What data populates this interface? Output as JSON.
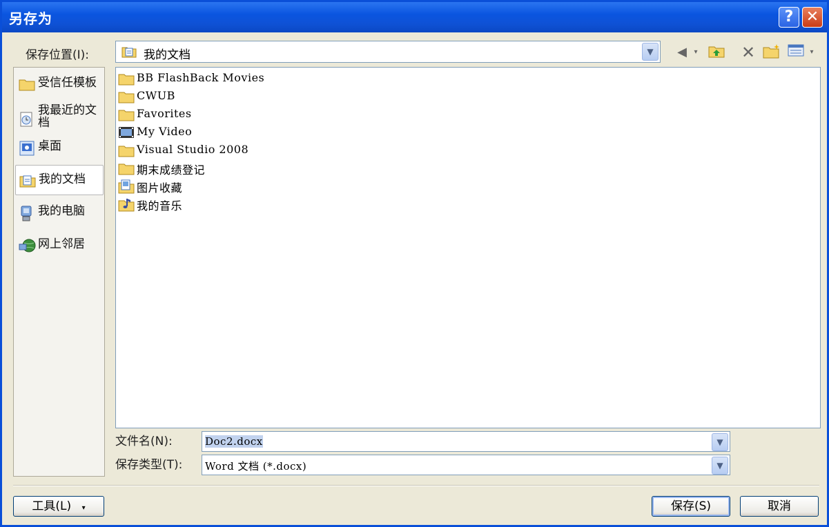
{
  "window": {
    "title": "另存为"
  },
  "location": {
    "label": "保存位置(I):",
    "value": "我的文档"
  },
  "places": [
    {
      "label": "受信任模板",
      "icon": "folder-icon"
    },
    {
      "label": "我最近的文档",
      "icon": "recent-documents-icon"
    },
    {
      "label": "桌面",
      "icon": "desktop-icon"
    },
    {
      "label": "我的文档",
      "icon": "my-documents-icon",
      "selected": true
    },
    {
      "label": "我的电脑",
      "icon": "my-computer-icon"
    },
    {
      "label": "网上邻居",
      "icon": "network-places-icon"
    }
  ],
  "files": [
    {
      "name": "BB FlashBack Movies",
      "icon": "folder-icon"
    },
    {
      "name": "CWUB",
      "icon": "folder-icon"
    },
    {
      "name": "Favorites",
      "icon": "folder-icon"
    },
    {
      "name": "My Video",
      "icon": "video-folder-icon"
    },
    {
      "name": "Visual Studio 2008",
      "icon": "folder-icon"
    },
    {
      "name": "期末成绩登记",
      "icon": "folder-icon"
    },
    {
      "name": "图片收藏",
      "icon": "pictures-folder-icon"
    },
    {
      "name": "我的音乐",
      "icon": "music-folder-icon"
    }
  ],
  "filename": {
    "label": "文件名(N):",
    "value": "Doc2.docx"
  },
  "filetype": {
    "label": "保存类型(T):",
    "value": "Word 文档 (*.docx)"
  },
  "buttons": {
    "tools": "工具(L)",
    "save": "保存(S)",
    "cancel": "取消"
  },
  "colors": {
    "titlebar": "#0a55e0",
    "close": "#c93b16"
  }
}
